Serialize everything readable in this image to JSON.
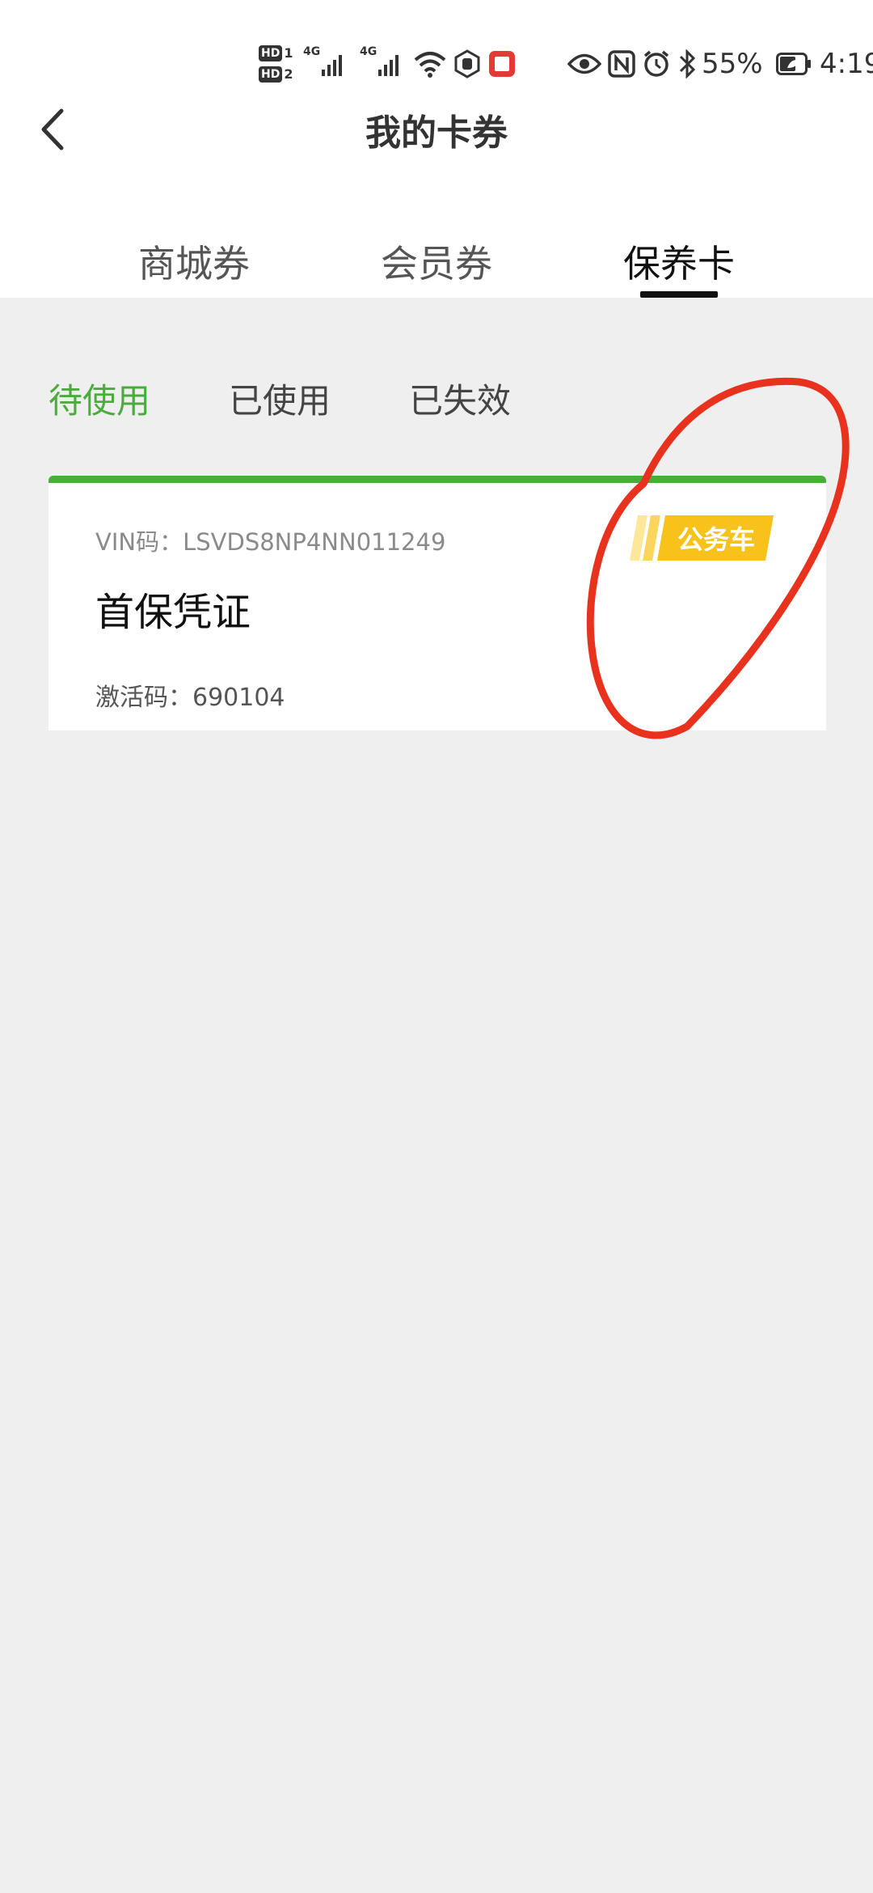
{
  "status_bar": {
    "hd1": "HD",
    "sim1": "1",
    "hd2": "HD",
    "sim2": "2",
    "net1": "4G",
    "net2": "4G",
    "battery": "55%",
    "time": "4:19"
  },
  "header": {
    "title": "我的卡券"
  },
  "tabs": [
    {
      "label": "商城券"
    },
    {
      "label": "会员券"
    },
    {
      "label": "保养卡"
    }
  ],
  "active_tab": "保养卡",
  "subtabs": [
    {
      "label": "待使用"
    },
    {
      "label": "已使用"
    },
    {
      "label": "已失效"
    }
  ],
  "active_subtab": "待使用",
  "card": {
    "vin": "VIN码：LSVDS8NP4NN011249",
    "badge": "公务车",
    "name": "首保凭证",
    "activation_code": "激活码：690104"
  },
  "colors": {
    "accent_green": "#4aac3d",
    "badge_yellow": "#f7c21a",
    "annotation_red": "#e8321e",
    "background": "#efefef"
  }
}
